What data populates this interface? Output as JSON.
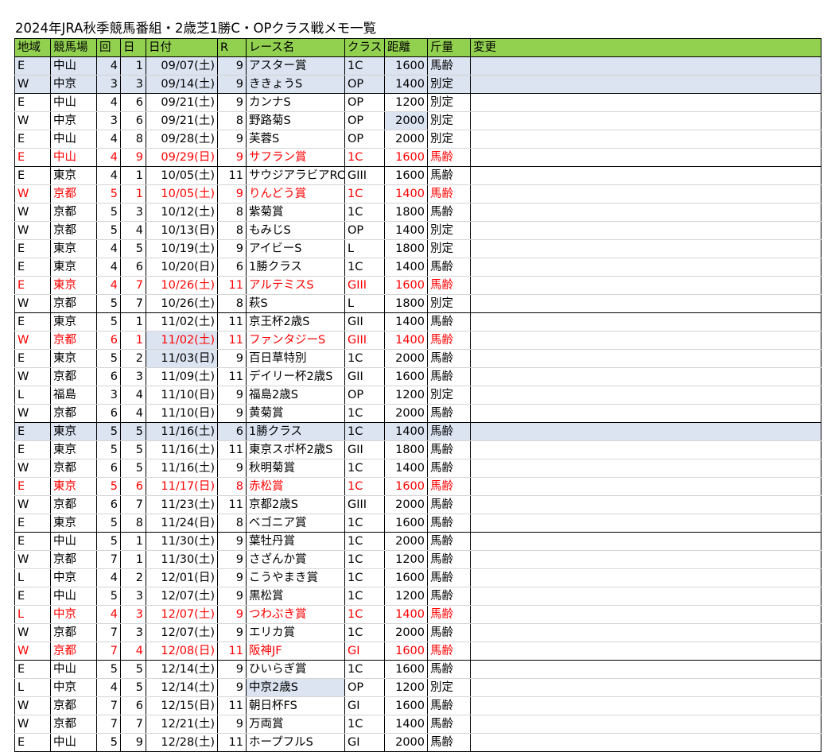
{
  "title": "2024年JRA秋季競馬番組・2歳芝1勝C・OPクラス戦メモ一覧",
  "headers": [
    "地域",
    "競馬場",
    "回",
    "日",
    "日付",
    "R",
    "レース名",
    "クラス",
    "距離",
    "斤量",
    "変更"
  ],
  "colors": {
    "header_bg": "#92d050",
    "highlight_bg": "#dce4f2",
    "red_text": "#ff0000"
  },
  "rows": [
    {
      "region": "E",
      "course": "中山",
      "kai": "4",
      "day": "1",
      "date": "09/07(土)",
      "race_no": "9",
      "name": "アスター賞",
      "cls": "1C",
      "dist": "1600",
      "weight": "馬齢",
      "change": ""
    },
    {
      "region": "W",
      "course": "中京",
      "kai": "3",
      "day": "3",
      "date": "09/14(土)",
      "race_no": "9",
      "name": "ききょうS",
      "cls": "OP",
      "dist": "1400",
      "weight": "別定",
      "change": ""
    },
    {
      "region": "E",
      "course": "中山",
      "kai": "4",
      "day": "6",
      "date": "09/21(土)",
      "race_no": "9",
      "name": "カンナS",
      "cls": "OP",
      "dist": "1200",
      "weight": "別定",
      "change": ""
    },
    {
      "region": "W",
      "course": "中京",
      "kai": "3",
      "day": "6",
      "date": "09/21(土)",
      "race_no": "8",
      "name": "野路菊S",
      "cls": "OP",
      "dist": "2000",
      "weight": "別定",
      "change": ""
    },
    {
      "region": "E",
      "course": "中山",
      "kai": "4",
      "day": "8",
      "date": "09/28(土)",
      "race_no": "9",
      "name": "芙蓉S",
      "cls": "OP",
      "dist": "2000",
      "weight": "別定",
      "change": ""
    },
    {
      "region": "E",
      "course": "中山",
      "kai": "4",
      "day": "9",
      "date": "09/29(日)",
      "race_no": "9",
      "name": "サフラン賞",
      "cls": "1C",
      "dist": "1600",
      "weight": "馬齢",
      "change": ""
    },
    {
      "region": "E",
      "course": "東京",
      "kai": "4",
      "day": "1",
      "date": "10/05(土)",
      "race_no": "11",
      "name": "サウジアラビアRC",
      "cls": "GIII",
      "dist": "1600",
      "weight": "馬齢",
      "change": ""
    },
    {
      "region": "W",
      "course": "京都",
      "kai": "5",
      "day": "1",
      "date": "10/05(土)",
      "race_no": "9",
      "name": "りんどう賞",
      "cls": "1C",
      "dist": "1400",
      "weight": "馬齢",
      "change": ""
    },
    {
      "region": "W",
      "course": "京都",
      "kai": "5",
      "day": "3",
      "date": "10/12(土)",
      "race_no": "8",
      "name": "紫菊賞",
      "cls": "1C",
      "dist": "1800",
      "weight": "馬齢",
      "change": ""
    },
    {
      "region": "W",
      "course": "京都",
      "kai": "5",
      "day": "4",
      "date": "10/13(日)",
      "race_no": "8",
      "name": "もみじS",
      "cls": "OP",
      "dist": "1400",
      "weight": "別定",
      "change": ""
    },
    {
      "region": "E",
      "course": "東京",
      "kai": "4",
      "day": "5",
      "date": "10/19(土)",
      "race_no": "9",
      "name": "アイビーS",
      "cls": "L",
      "dist": "1800",
      "weight": "別定",
      "change": ""
    },
    {
      "region": "E",
      "course": "東京",
      "kai": "4",
      "day": "6",
      "date": "10/20(日)",
      "race_no": "6",
      "name": "1勝クラス",
      "cls": "1C",
      "dist": "1400",
      "weight": "馬齢",
      "change": ""
    },
    {
      "region": "E",
      "course": "東京",
      "kai": "4",
      "day": "7",
      "date": "10/26(土)",
      "race_no": "11",
      "name": "アルテミスS",
      "cls": "GIII",
      "dist": "1600",
      "weight": "馬齢",
      "change": ""
    },
    {
      "region": "W",
      "course": "京都",
      "kai": "5",
      "day": "7",
      "date": "10/26(土)",
      "race_no": "8",
      "name": "萩S",
      "cls": "L",
      "dist": "1800",
      "weight": "別定",
      "change": ""
    },
    {
      "region": "E",
      "course": "東京",
      "kai": "5",
      "day": "1",
      "date": "11/02(土)",
      "race_no": "11",
      "name": "京王杯2歳S",
      "cls": "GII",
      "dist": "1400",
      "weight": "馬齢",
      "change": ""
    },
    {
      "region": "W",
      "course": "京都",
      "kai": "6",
      "day": "1",
      "date": "11/02(土)",
      "race_no": "11",
      "name": "ファンタジーS",
      "cls": "GIII",
      "dist": "1400",
      "weight": "馬齢",
      "change": ""
    },
    {
      "region": "E",
      "course": "東京",
      "kai": "5",
      "day": "2",
      "date": "11/03(日)",
      "race_no": "9",
      "name": "百日草特別",
      "cls": "1C",
      "dist": "2000",
      "weight": "馬齢",
      "change": ""
    },
    {
      "region": "W",
      "course": "京都",
      "kai": "6",
      "day": "3",
      "date": "11/09(土)",
      "race_no": "11",
      "name": "デイリー杯2歳S",
      "cls": "GII",
      "dist": "1600",
      "weight": "馬齢",
      "change": ""
    },
    {
      "region": "L",
      "course": "福島",
      "kai": "3",
      "day": "4",
      "date": "11/10(日)",
      "race_no": "9",
      "name": "福島2歳S",
      "cls": "OP",
      "dist": "1200",
      "weight": "別定",
      "change": ""
    },
    {
      "region": "W",
      "course": "京都",
      "kai": "6",
      "day": "4",
      "date": "11/10(日)",
      "race_no": "9",
      "name": "黄菊賞",
      "cls": "1C",
      "dist": "2000",
      "weight": "馬齢",
      "change": ""
    },
    {
      "region": "E",
      "course": "東京",
      "kai": "5",
      "day": "5",
      "date": "11/16(土)",
      "race_no": "6",
      "name": "1勝クラス",
      "cls": "1C",
      "dist": "1400",
      "weight": "馬齢",
      "change": ""
    },
    {
      "region": "E",
      "course": "東京",
      "kai": "5",
      "day": "5",
      "date": "11/16(土)",
      "race_no": "11",
      "name": "東京スポ杯2歳S",
      "cls": "GII",
      "dist": "1800",
      "weight": "馬齢",
      "change": ""
    },
    {
      "region": "W",
      "course": "京都",
      "kai": "6",
      "day": "5",
      "date": "11/16(土)",
      "race_no": "9",
      "name": "秋明菊賞",
      "cls": "1C",
      "dist": "1400",
      "weight": "馬齢",
      "change": ""
    },
    {
      "region": "E",
      "course": "東京",
      "kai": "5",
      "day": "6",
      "date": "11/17(日)",
      "race_no": "8",
      "name": "赤松賞",
      "cls": "1C",
      "dist": "1600",
      "weight": "馬齢",
      "change": ""
    },
    {
      "region": "W",
      "course": "京都",
      "kai": "6",
      "day": "7",
      "date": "11/23(土)",
      "race_no": "11",
      "name": "京都2歳S",
      "cls": "GIII",
      "dist": "2000",
      "weight": "馬齢",
      "change": ""
    },
    {
      "region": "E",
      "course": "東京",
      "kai": "5",
      "day": "8",
      "date": "11/24(日)",
      "race_no": "8",
      "name": "ベゴニア賞",
      "cls": "1C",
      "dist": "1600",
      "weight": "馬齢",
      "change": ""
    },
    {
      "region": "E",
      "course": "中山",
      "kai": "5",
      "day": "1",
      "date": "11/30(土)",
      "race_no": "9",
      "name": "葉牡丹賞",
      "cls": "1C",
      "dist": "2000",
      "weight": "馬齢",
      "change": ""
    },
    {
      "region": "W",
      "course": "京都",
      "kai": "7",
      "day": "1",
      "date": "11/30(土)",
      "race_no": "9",
      "name": "さざんか賞",
      "cls": "1C",
      "dist": "1200",
      "weight": "馬齢",
      "change": ""
    },
    {
      "region": "L",
      "course": "中京",
      "kai": "4",
      "day": "2",
      "date": "12/01(日)",
      "race_no": "9",
      "name": "こうやまき賞",
      "cls": "1C",
      "dist": "1600",
      "weight": "馬齢",
      "change": ""
    },
    {
      "region": "E",
      "course": "中山",
      "kai": "5",
      "day": "3",
      "date": "12/07(土)",
      "race_no": "9",
      "name": "黒松賞",
      "cls": "1C",
      "dist": "1200",
      "weight": "馬齢",
      "change": ""
    },
    {
      "region": "L",
      "course": "中京",
      "kai": "4",
      "day": "3",
      "date": "12/07(土)",
      "race_no": "9",
      "name": "つわぶき賞",
      "cls": "1C",
      "dist": "1400",
      "weight": "馬齢",
      "change": ""
    },
    {
      "region": "W",
      "course": "京都",
      "kai": "7",
      "day": "3",
      "date": "12/07(土)",
      "race_no": "9",
      "name": "エリカ賞",
      "cls": "1C",
      "dist": "2000",
      "weight": "馬齢",
      "change": ""
    },
    {
      "region": "W",
      "course": "京都",
      "kai": "7",
      "day": "4",
      "date": "12/08(日)",
      "race_no": "11",
      "name": "阪神JF",
      "cls": "GI",
      "dist": "1600",
      "weight": "馬齢",
      "change": ""
    },
    {
      "region": "E",
      "course": "中山",
      "kai": "5",
      "day": "5",
      "date": "12/14(土)",
      "race_no": "9",
      "name": "ひいらぎ賞",
      "cls": "1C",
      "dist": "1600",
      "weight": "馬齢",
      "change": ""
    },
    {
      "region": "L",
      "course": "中京",
      "kai": "4",
      "day": "5",
      "date": "12/14(土)",
      "race_no": "9",
      "name": "中京2歳S",
      "cls": "OP",
      "dist": "1200",
      "weight": "別定",
      "change": ""
    },
    {
      "region": "W",
      "course": "京都",
      "kai": "7",
      "day": "6",
      "date": "12/15(日)",
      "race_no": "11",
      "name": "朝日杯FS",
      "cls": "GI",
      "dist": "1600",
      "weight": "馬齢",
      "change": ""
    },
    {
      "region": "W",
      "course": "京都",
      "kai": "7",
      "day": "7",
      "date": "12/21(土)",
      "race_no": "9",
      "name": "万両賞",
      "cls": "1C",
      "dist": "1400",
      "weight": "馬齢",
      "change": ""
    },
    {
      "region": "E",
      "course": "中山",
      "kai": "5",
      "day": "9",
      "date": "12/28(土)",
      "race_no": "11",
      "name": "ホープフルS",
      "cls": "GI",
      "dist": "2000",
      "weight": "馬齢",
      "change": ""
    }
  ]
}
